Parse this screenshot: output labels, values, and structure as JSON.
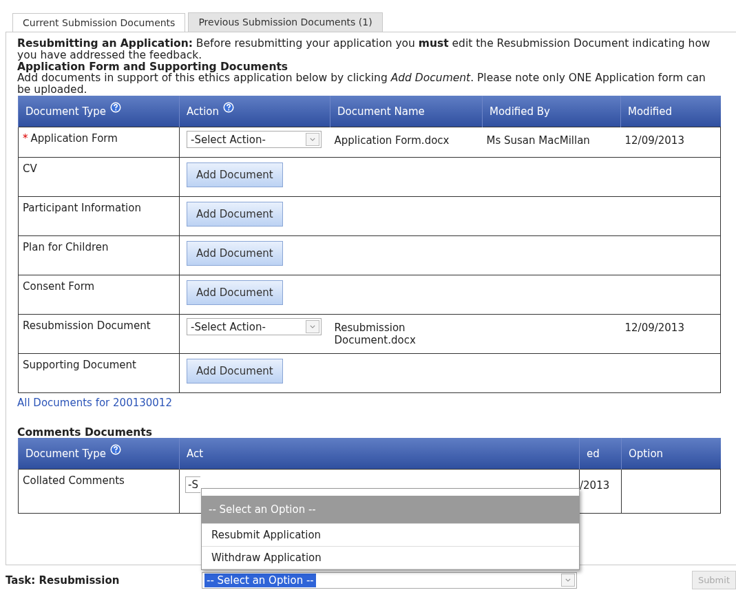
{
  "tabs": [
    {
      "label": "Current Submission Documents",
      "selected": true
    },
    {
      "label": "Previous Submission Documents (1)",
      "selected": false
    }
  ],
  "intro": "**Resubmitting an Application:** Before resubmitting your application you **must** edit the Resubmission Document indicating how you have addressed the feedback.",
  "section_title": "Application Form and Supporting Documents",
  "section_note": "Add documents in support of this ethics application below by clicking *Add Document*. Please note only ONE Application form can be uploaded.",
  "documents_table": {
    "required_marker": "*",
    "columns": [
      {
        "label": "Document Type",
        "help": true
      },
      {
        "label": "Action",
        "help": true
      },
      {
        "label": "Document Name",
        "help": false
      },
      {
        "label": "Modified By",
        "help": false
      },
      {
        "label": "Modified",
        "help": false
      }
    ],
    "rows": [
      {
        "type": "Application Form",
        "required": true,
        "kind": "select",
        "action": "-Select Action-",
        "document_name": "Application Form.docx",
        "modified_by": "Ms Susan MacMillan",
        "modified": "12/09/2013"
      },
      {
        "type": "CV",
        "required": false,
        "kind": "button",
        "action": "Add Document"
      },
      {
        "type": "Participant Information",
        "required": false,
        "kind": "button",
        "action": "Add Document"
      },
      {
        "type": "Plan for Children",
        "required": false,
        "kind": "button",
        "action": "Add Document"
      },
      {
        "type": "Consent Form",
        "required": false,
        "kind": "button",
        "action": "Add Document"
      },
      {
        "type": "Resubmission Document",
        "required": false,
        "kind": "select",
        "action": "-Select Action-",
        "document_name": "Resubmission Document.docx",
        "modified": "12/09/2013"
      },
      {
        "type": "Supporting Document",
        "required": false,
        "kind": "button",
        "action": "Add Document"
      }
    ]
  },
  "all_documents_link": "All Documents for 200130012",
  "comments_title": "Comments Documents",
  "comments_table": {
    "columns": [
      {
        "label": "Document Type",
        "help": true
      },
      {
        "label": "Act",
        "help": false
      },
      {
        "label": "ed",
        "help": false
      },
      {
        "label": "Option",
        "help": false
      }
    ],
    "rows": [
      {
        "type": "Collated Comments",
        "action": "-S",
        "modified": "/2013"
      }
    ]
  },
  "dropdown_options": [
    {
      "label": "-- Select an Option --",
      "selected": true
    },
    {
      "label": "Resubmit Application",
      "selected": false
    },
    {
      "label": "Withdraw Application",
      "selected": false
    }
  ],
  "task": {
    "label": "Task: Resubmission",
    "value": "-- Select an Option --",
    "submit": "Submit",
    "submit_disabled": true
  }
}
